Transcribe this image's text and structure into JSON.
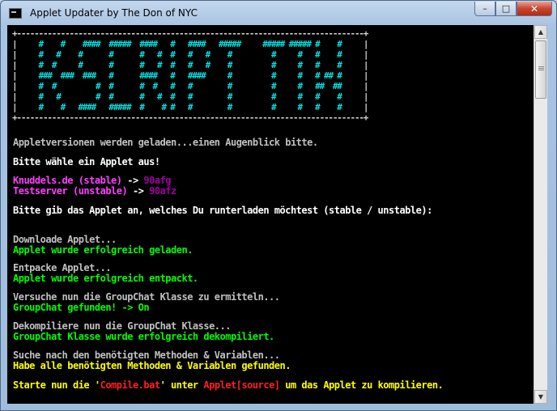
{
  "window": {
    "title": "Applet Updater by The Don of NYC",
    "controls": {
      "minimize": "–",
      "maximize": "□",
      "close": "✕"
    },
    "icon": "console-app-icon"
  },
  "banner": {
    "border_top": "+-------------------------------------------------------------------------------+",
    "border_side": "|",
    "art_rows": [
      "     #    #    ####  #####  ####   #   ####   #####     ##### ##### #    #     ",
      "     #   #    #      #      #   #  #   #   #    #         #     #   #    #     ",
      "     #  #     #      #      #   #  #   #   #    #         #     #   #    #     ",
      "     ###  ###  ###   #      ####   #   ####     #         #     #   # ## #     ",
      "     #  #         #  #      #  #   #   #        #         #     #   ##  ##     ",
      "     #   #        #  #      #   #  #   #        #         #     #   #    #     ",
      "     #    #   ####   #####  #    # #   #        #         #     #   #    #     "
    ],
    "border_bottom": "+-------------------------------------------------------------------------------+"
  },
  "console": {
    "loading": "Appletversionen werden geladen...einen Augenblick bitte.",
    "choose": "Bitte wähle ein Applet aus!",
    "versions": [
      {
        "name": "Knuddels.de (stable)",
        "arrow": " -> ",
        "version": "90afg"
      },
      {
        "name": "Testserver (unstable)",
        "arrow": " -> ",
        "version": "90afz"
      }
    ],
    "prompt": "Bitte gib das Applet an, welches Du runterladen möchtest (stable / unstable):",
    "download": "Downloade Applet...",
    "download_ok": "Applet wurde erfolgreich geladen.",
    "unpack": "Entpacke Applet...",
    "unpack_ok": "Applet wurde erfolgreich entpackt.",
    "groupchat_find": "Versuche nun die GroupChat Klasse zu ermitteln...",
    "groupchat_found": "GroupChat gefunden! -> On",
    "decompile": "Dekompiliere nun die GroupChat Klasse...",
    "decompile_ok": "GroupChat Klasse wurde erfolgreich dekompiliert.",
    "search_methods": "Suche nach den benötigten Methoden & Variablen...",
    "methods_found": "Habe alle benötigten Methoden & Variablen gefunden.",
    "final": {
      "prefix": "Starte nun die '",
      "file": "Compile.bat",
      "middle": "' unter ",
      "path": "Applet[source]",
      "suffix": " um das Applet zu kompilieren."
    }
  },
  "scrollbar": {
    "up": "▲",
    "down": "▼"
  },
  "colors": {
    "console_bg": "#000000",
    "banner_art": "#00e6e6",
    "text_gray": "#c0c0c0",
    "text_success": "#00ff00",
    "text_highlight": "#ff40ff",
    "text_warning": "#ffff00",
    "text_error_red": "#ff2020"
  }
}
